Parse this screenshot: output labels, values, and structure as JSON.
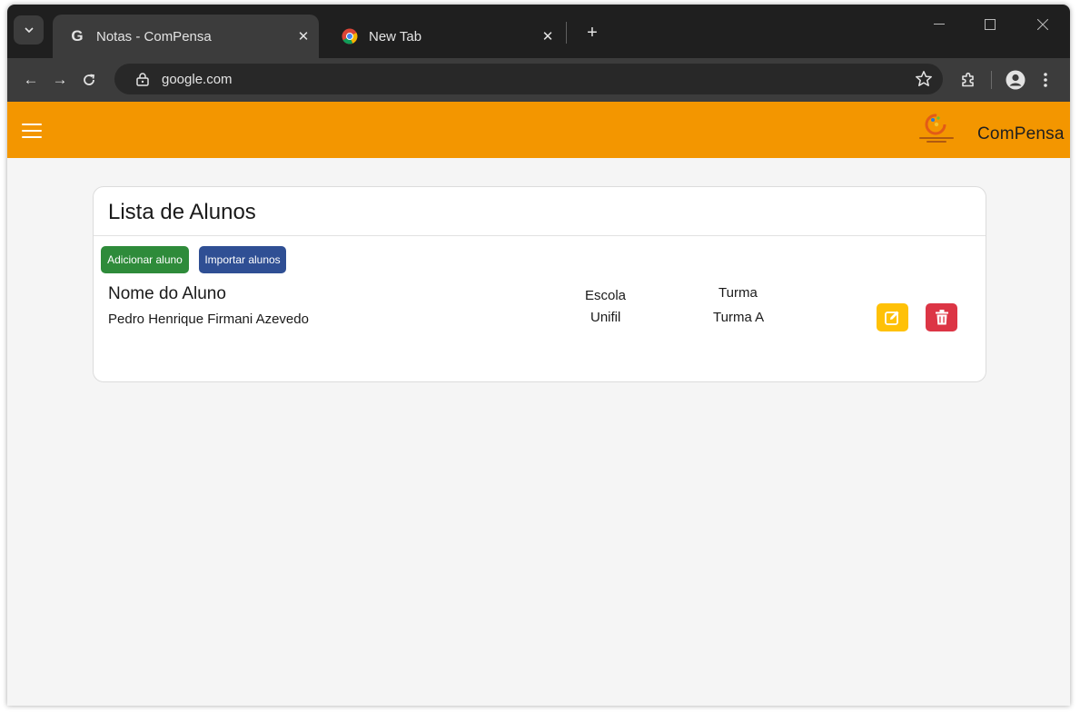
{
  "browser": {
    "tab_search_icon": "chevron-down-icon",
    "tabs": [
      {
        "title": "Notas - ComPensa",
        "favicon": "google-g-icon",
        "active": true
      },
      {
        "title": "New Tab",
        "favicon": "chrome-icon",
        "active": false
      }
    ],
    "url": "google.com"
  },
  "app": {
    "brand": "ComPensa",
    "accent_color": "#f39600"
  },
  "card": {
    "title": "Lista de Alunos",
    "buttons": {
      "add": "Adicionar aluno",
      "import": "Importar alunos"
    },
    "columns": {
      "name": "Nome do Aluno",
      "school": "Escola",
      "class": "Turma"
    },
    "rows": [
      {
        "name": "Pedro Henrique Firmani Azevedo",
        "school": "Unifil",
        "class": "Turma A"
      }
    ],
    "colors": {
      "add_button": "#2e8b3a",
      "import_button": "#2f4f94",
      "edit_button": "#ffc107",
      "delete_button": "#dc3545"
    }
  }
}
